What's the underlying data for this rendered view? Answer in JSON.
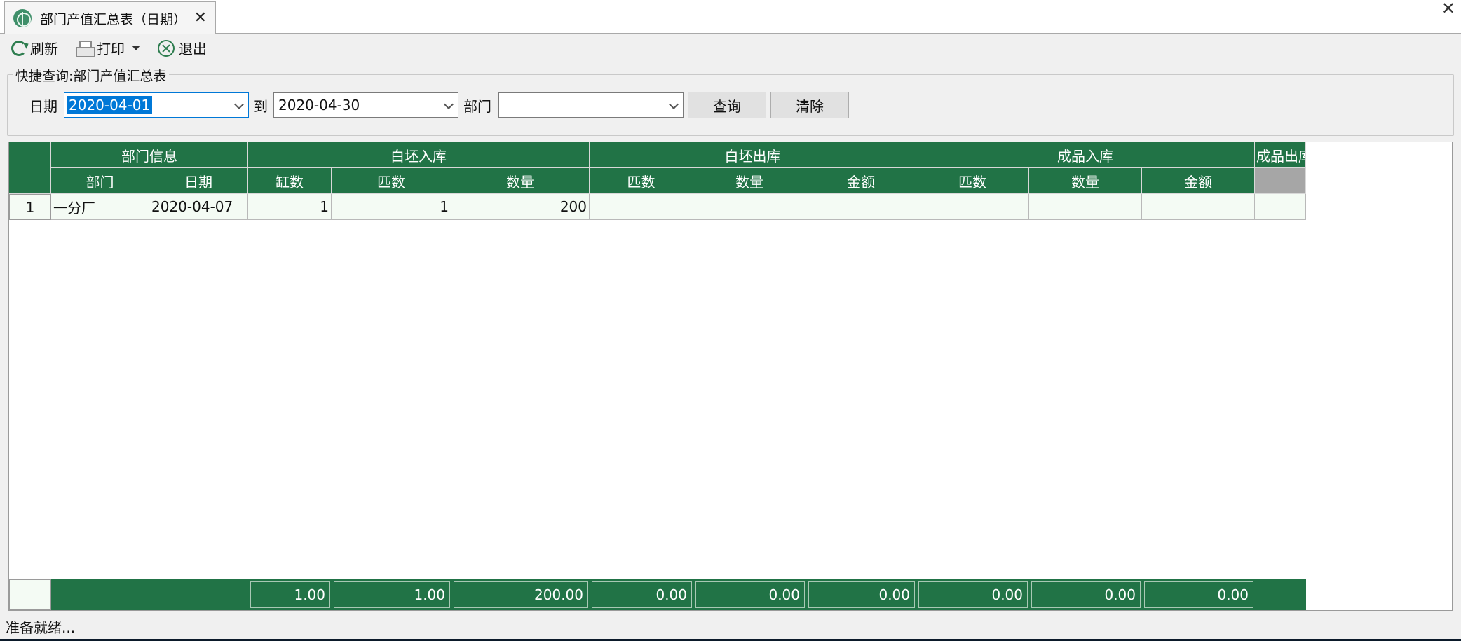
{
  "tab": {
    "title": "部门产值汇总表（日期）",
    "close": "✕"
  },
  "window": {
    "close": "✕"
  },
  "toolbar": {
    "refresh": "刷新",
    "print": "打印",
    "exit": "退出"
  },
  "quick": {
    "legend": "快捷查询:部门产值汇总表",
    "date_label": "日期",
    "date_from": "2020-04-01",
    "to_label": "到",
    "date_to": "2020-04-30",
    "dept_label": "部门",
    "dept_value": "",
    "query_btn": "查询",
    "clear_btn": "清除"
  },
  "grid": {
    "groups": [
      "部门信息",
      "白坯入库",
      "白坯出库",
      "成品入库",
      "成品出库"
    ],
    "columns": [
      "部门",
      "日期",
      "缸数",
      "匹数",
      "数量",
      "匹数",
      "数量",
      "金额",
      "匹数",
      "数量",
      "金额"
    ],
    "rows": [
      {
        "no": "1",
        "cells": [
          "一分厂",
          "2020-04-07",
          "1",
          "1",
          "200",
          "",
          "",
          "",
          "",
          "",
          "",
          ""
        ]
      }
    ],
    "totals": [
      "1.00",
      "1.00",
      "200.00",
      "0.00",
      "0.00",
      "0.00",
      "0.00",
      "0.00",
      "0.00"
    ]
  },
  "status": {
    "text": "准备就绪..."
  }
}
